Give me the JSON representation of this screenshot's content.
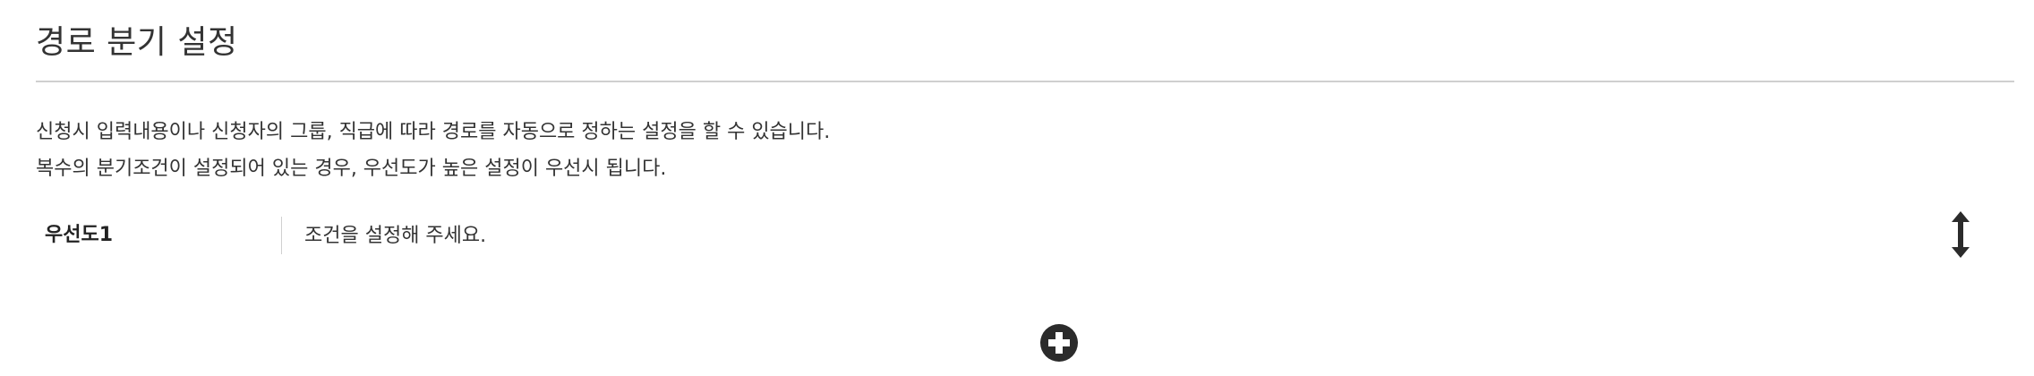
{
  "header": {
    "title": "경로 분기 설정"
  },
  "description": {
    "line1": "신청시 입력내용이나 신청자의 그룹, 직급에 따라 경로를 자동으로 정하는 설정을 할 수 있습니다.",
    "line2": "복수의 분기조건이 설정되어 있는 경우, 우선도가 높은 설정이 우선시 됩니다."
  },
  "rules": [
    {
      "priority_label": "우선도1",
      "condition_text": "조건을 설정해 주세요.",
      "drag_icon": "vertical-resize-arrow-icon"
    }
  ],
  "add_icon": "plus-circle-icon",
  "colors": {
    "text": "#333333",
    "divider": "#cfcfcf",
    "icon": "#2b2b2b"
  }
}
